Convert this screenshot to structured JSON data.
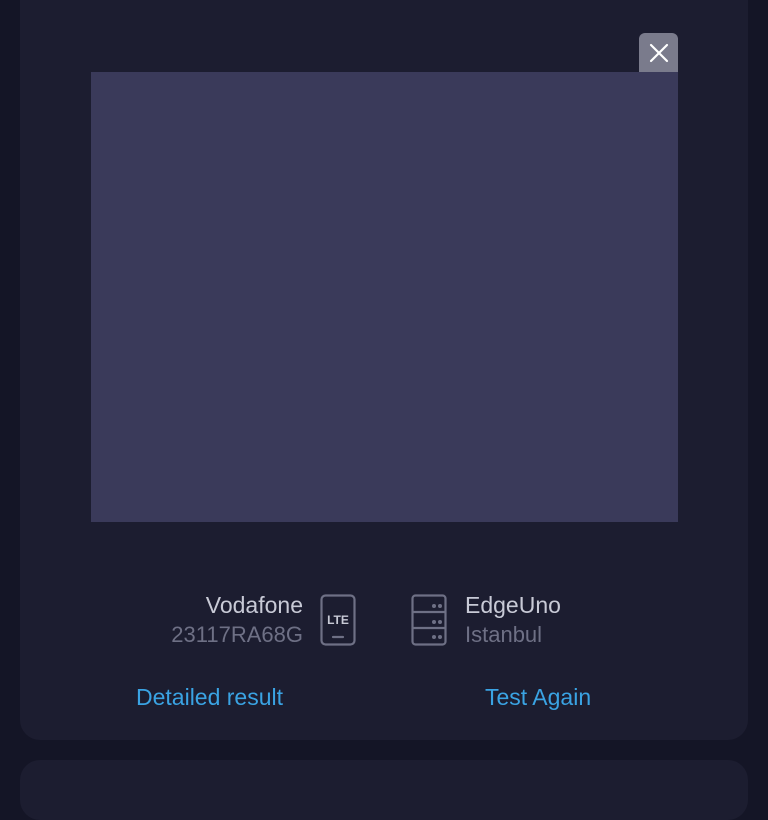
{
  "ad": {
    "close_icon": "close-icon"
  },
  "provider": {
    "name": "Vodafone",
    "device": "23117RA68G",
    "network_badge": "LTE",
    "icon": "phone-lte-icon"
  },
  "server": {
    "name": "EdgeUno",
    "location": "Istanbul",
    "icon": "server-icon"
  },
  "actions": {
    "detailed_result": "Detailed result",
    "test_again": "Test Again"
  },
  "colors": {
    "background": "#141526",
    "card": "#1c1d30",
    "ad_placeholder": "#3a3a5a",
    "accent": "#3aa3e3",
    "primary_text": "#c8cad6",
    "secondary_text": "#6e7085"
  }
}
